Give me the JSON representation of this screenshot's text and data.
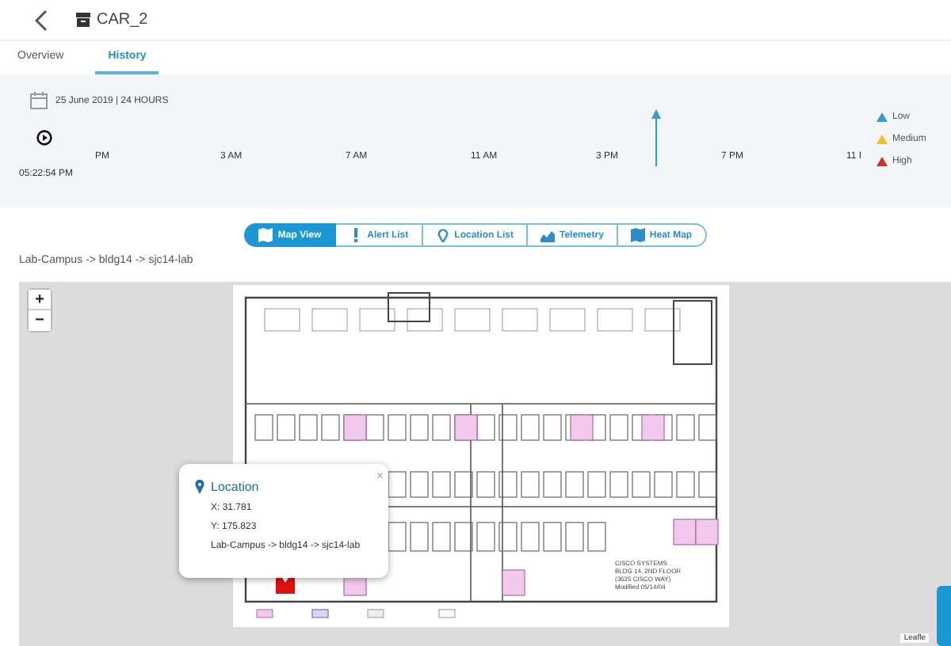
{
  "header": {
    "title": "CAR_2"
  },
  "tabs": [
    {
      "label": "Overview",
      "selected": false
    },
    {
      "label": "History",
      "selected": true
    }
  ],
  "timeline": {
    "date": "25 June 2019 | 24 HOURS",
    "current_time": "05:22:54 PM",
    "ticks": [
      "PM",
      "3 AM",
      "7 AM",
      "11 AM",
      "3 PM",
      "7 PM",
      "11 I"
    ],
    "legend": [
      {
        "label": "Low",
        "color": "#2a9fd6"
      },
      {
        "label": "Medium",
        "color": "#f0c419"
      },
      {
        "label": "High",
        "color": "#d0312d"
      }
    ]
  },
  "views": [
    {
      "label": "Map View",
      "kind": "map",
      "selected": true
    },
    {
      "label": "Alert List",
      "kind": "alert",
      "selected": false
    },
    {
      "label": "Location List",
      "kind": "pin",
      "selected": false
    },
    {
      "label": "Telemetry",
      "kind": "chart",
      "selected": false
    },
    {
      "label": "Heat Map",
      "kind": "map",
      "selected": false
    }
  ],
  "breadcrumb": "Lab-Campus -> bldg14 -> sjc14-lab",
  "map": {
    "zoom_in": "+",
    "zoom_out": "−",
    "attribution": "Leafle",
    "plan_caption": [
      "CISCO SYSTEMS",
      "BLDG 14, 2ND FLOOR",
      "(3625 CISCO WAY)",
      "Modified 05/14/04"
    ],
    "popup": {
      "close": "×",
      "title": "Location",
      "x": "X: 31.781",
      "y": "Y: 175.823",
      "path": "Lab-Campus -> bldg14 -> sjc14-lab"
    }
  }
}
